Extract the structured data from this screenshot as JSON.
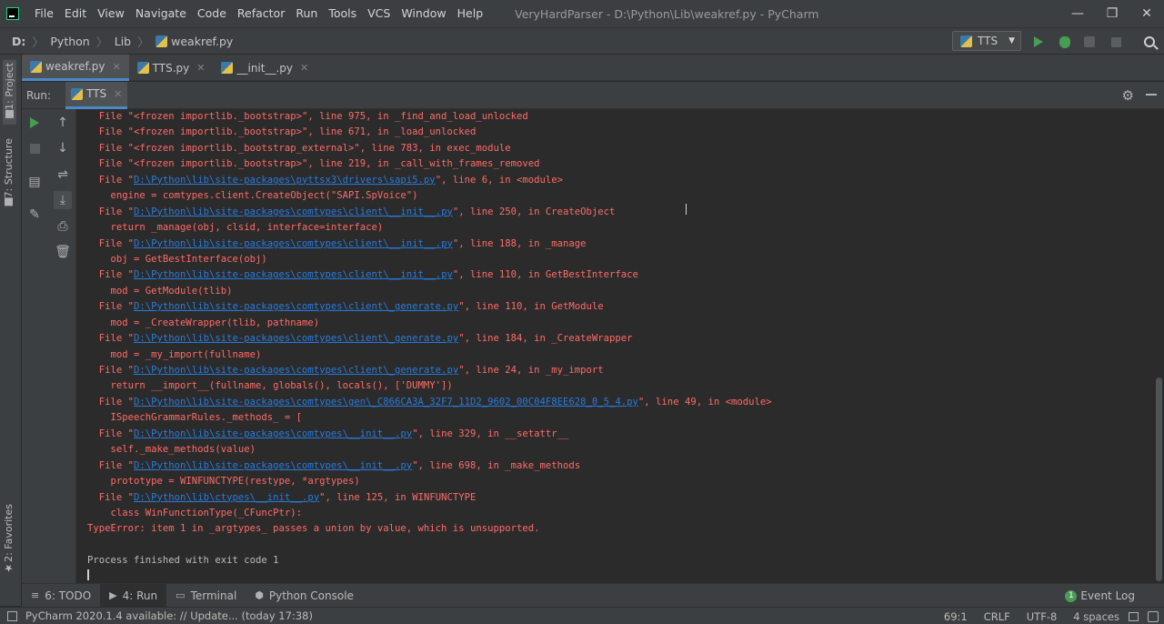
{
  "menu": [
    "File",
    "Edit",
    "View",
    "Navigate",
    "Code",
    "Refactor",
    "Run",
    "Tools",
    "VCS",
    "Window",
    "Help"
  ],
  "window_title": "VeryHardParser - D:\\Python\\Lib\\weakref.py - PyCharm",
  "window_controls": {
    "minimize": "—",
    "restore": "❐",
    "close": "✕"
  },
  "breadcrumb": {
    "drive": "D:",
    "folder1": "Python",
    "folder2": "Lib",
    "file": "weakref.py"
  },
  "run_config": {
    "name": "TTS"
  },
  "editor_tabs": [
    {
      "label": "weakref.py",
      "close": "✕"
    },
    {
      "label": "TTS.py",
      "close": "✕"
    },
    {
      "label": "__init__.py",
      "close": "✕"
    }
  ],
  "side_tabs": {
    "project": "1: Project",
    "structure": "7: Structure",
    "favorites": "2: Favorites"
  },
  "run_panel": {
    "label": "Run:",
    "tab": "TTS",
    "close": "✕"
  },
  "console": {
    "lines": [
      {
        "pre": "  File \"<frozen importlib._bootstrap>\", line 975, in _find_and_load_unlocked",
        "link": "",
        "post": "",
        "style": ""
      },
      {
        "pre": "  File \"<frozen importlib._bootstrap>\", line 671, in _load_unlocked",
        "link": "",
        "post": "",
        "style": ""
      },
      {
        "pre": "  File \"<frozen importlib._bootstrap_external>\", line 783, in exec_module",
        "link": "",
        "post": "",
        "style": ""
      },
      {
        "pre": "  File \"<frozen importlib._bootstrap>\", line 219, in _call_with_frames_removed",
        "link": "",
        "post": "",
        "style": ""
      },
      {
        "pre": "  File \"",
        "link": "D:\\Python\\lib\\site-packages\\pyttsx3\\drivers\\sapi5.py",
        "post": "\", line 6, in <module>",
        "style": ""
      },
      {
        "pre": "    engine = comtypes.client.CreateObject(\"SAPI.SpVoice\")",
        "link": "",
        "post": "",
        "style": ""
      },
      {
        "pre": "  File \"",
        "link": "D:\\Python\\lib\\site-packages\\comtypes\\client\\__init__.py",
        "post": "\", line 250, in CreateObject",
        "style": ""
      },
      {
        "pre": "    return _manage(obj, clsid, interface=interface)",
        "link": "",
        "post": "",
        "style": ""
      },
      {
        "pre": "  File \"",
        "link": "D:\\Python\\lib\\site-packages\\comtypes\\client\\__init__.py",
        "post": "\", line 188, in _manage",
        "style": ""
      },
      {
        "pre": "    obj = GetBestInterface(obj)",
        "link": "",
        "post": "",
        "style": ""
      },
      {
        "pre": "  File \"",
        "link": "D:\\Python\\lib\\site-packages\\comtypes\\client\\__init__.py",
        "post": "\", line 110, in GetBestInterface",
        "style": ""
      },
      {
        "pre": "    mod = GetModule(tlib)",
        "link": "",
        "post": "",
        "style": ""
      },
      {
        "pre": "  File \"",
        "link": "D:\\Python\\lib\\site-packages\\comtypes\\client\\_generate.py",
        "post": "\", line 110, in GetModule",
        "style": ""
      },
      {
        "pre": "    mod = _CreateWrapper(tlib, pathname)",
        "link": "",
        "post": "",
        "style": ""
      },
      {
        "pre": "  File \"",
        "link": "D:\\Python\\lib\\site-packages\\comtypes\\client\\_generate.py",
        "post": "\", line 184, in _CreateWrapper",
        "style": ""
      },
      {
        "pre": "    mod = _my_import(fullname)",
        "link": "",
        "post": "",
        "style": ""
      },
      {
        "pre": "  File \"",
        "link": "D:\\Python\\lib\\site-packages\\comtypes\\client\\_generate.py",
        "post": "\", line 24, in _my_import",
        "style": ""
      },
      {
        "pre": "    return __import__(fullname, globals(), locals(), ['DUMMY'])",
        "link": "",
        "post": "",
        "style": ""
      },
      {
        "pre": "  File \"",
        "link": "D:\\Python\\lib\\site-packages\\comtypes\\gen\\_C866CA3A_32F7_11D2_9602_00C04F8EE628_0_5_4.py",
        "post": "\", line 49, in <module>",
        "style": ""
      },
      {
        "pre": "    ISpeechGrammarRules._methods_ = [",
        "link": "",
        "post": "",
        "style": ""
      },
      {
        "pre": "  File \"",
        "link": "D:\\Python\\lib\\site-packages\\comtypes\\__init__.py",
        "post": "\", line 329, in __setattr__",
        "style": ""
      },
      {
        "pre": "    self._make_methods(value)",
        "link": "",
        "post": "",
        "style": ""
      },
      {
        "pre": "  File \"",
        "link": "D:\\Python\\lib\\site-packages\\comtypes\\__init__.py",
        "post": "\", line 698, in _make_methods",
        "style": ""
      },
      {
        "pre": "    prototype = WINFUNCTYPE(restype, *argtypes)",
        "link": "",
        "post": "",
        "style": ""
      },
      {
        "pre": "  File \"",
        "link": "D:\\Python\\lib\\ctypes\\__init__.py",
        "post": "\", line 125, in WINFUNCTYPE",
        "style": ""
      },
      {
        "pre": "    class WinFunctionType(_CFuncPtr):",
        "link": "",
        "post": "",
        "style": ""
      },
      {
        "pre": "TypeError: item 1 in _argtypes_ passes a union by value, which is unsupported.",
        "link": "",
        "post": "",
        "style": ""
      },
      {
        "pre": "",
        "link": "",
        "post": "",
        "style": "plain"
      },
      {
        "pre": "Process finished with exit code 1",
        "link": "",
        "post": "",
        "style": "plain"
      }
    ]
  },
  "bottom_tabs": [
    {
      "icon": "≡",
      "label": "6: TODO"
    },
    {
      "icon": "▶",
      "label": "4: Run"
    },
    {
      "icon": "▭",
      "label": "Terminal"
    },
    {
      "icon": "⬢",
      "label": "Python Console"
    }
  ],
  "event_log": {
    "count": "1",
    "label": "Event Log"
  },
  "status": {
    "message": "PyCharm 2020.1.4 available: // Update... (today 17:38)",
    "position": "69:1",
    "line_sep": "CRLF",
    "encoding": "UTF-8",
    "indent": "4 spaces"
  }
}
